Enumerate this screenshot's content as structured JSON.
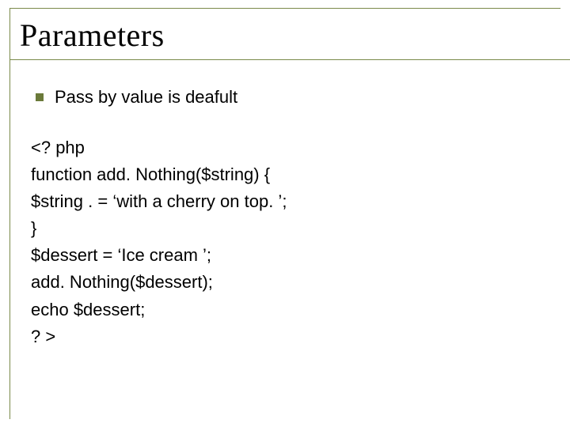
{
  "title": "Parameters",
  "bullet": "Pass by value is deafult",
  "code": {
    "l1": "<? php",
    "l2": "function add. Nothing($string) {",
    "l3": "$string . = ‘with a cherry on top. ’;",
    "l4": "}",
    "l5": "$dessert = ‘Ice cream ’;",
    "l6": "add. Nothing($dessert);",
    "l7": "echo $dessert;",
    "l8": "? >"
  }
}
